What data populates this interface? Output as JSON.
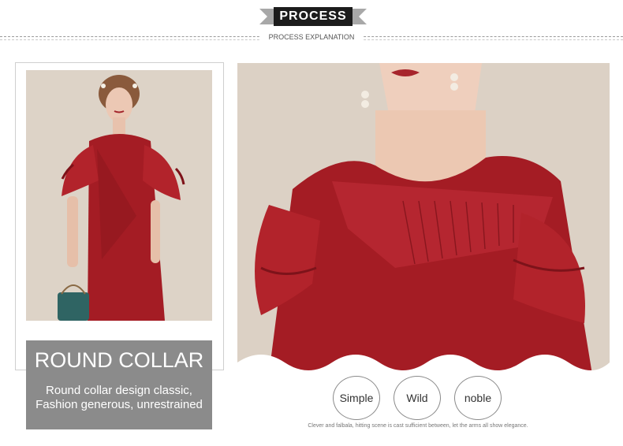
{
  "header": {
    "title": "PROCESS",
    "subtitle": "PROCESS EXPLANATION"
  },
  "caption": {
    "title": "ROUND COLLAR",
    "line1": "Round collar design classic,",
    "line2": "Fashion generous, unrestrained"
  },
  "keywords": [
    "Simple",
    "Wild",
    "noble"
  ],
  "footnote": "Clever and falbala, hitting scene is cast sufficient between, let the arms all show elegance.",
  "colors": {
    "dress": "#a41c24",
    "caption_bg": "#8b8b8b",
    "banner": "#1c1c1c"
  }
}
